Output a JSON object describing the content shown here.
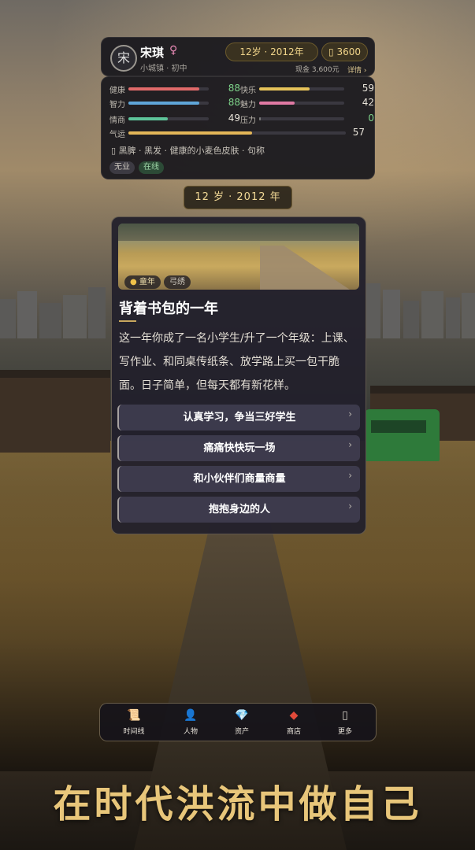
{
  "profile": {
    "avatar_char": "宋",
    "name": "宋琪",
    "gender_symbol": "♀",
    "location": "小城镇 · 初中",
    "age_label": "12岁 · 2012年",
    "coins": "3600",
    "cash": "现金 3,600元",
    "detail_label": "详情"
  },
  "stats": [
    {
      "label": "健康",
      "value": "88",
      "fraction": 0.88,
      "color": "#e06a6a",
      "value_color": "#7ed38a"
    },
    {
      "label": "快乐",
      "value": "59",
      "fraction": 0.59,
      "color": "#e6c35a",
      "value_color": "#e9e4da"
    },
    {
      "label": "智力",
      "value": "88",
      "fraction": 0.88,
      "color": "#5fa6d9",
      "value_color": "#7ed38a"
    },
    {
      "label": "魅力",
      "value": "42",
      "fraction": 0.42,
      "color": "#e07aa4",
      "value_color": "#e9e4da"
    },
    {
      "label": "情商",
      "value": "49",
      "fraction": 0.49,
      "color": "#5ec49a",
      "value_color": "#e9e4da"
    },
    {
      "label": "压力",
      "value": "0",
      "fraction": 0.0,
      "color": "#7a7a7a",
      "value_color": "#7ed38a"
    },
    {
      "label": "气运",
      "value": "57",
      "fraction": 0.57,
      "color": "#e3b658",
      "value_color": "#e9e4da"
    }
  ],
  "appearance": "黑脾 · 黑发 · 健康的小麦色皮肤 · 句称",
  "tags": [
    "无业",
    "在线"
  ],
  "year_banner": "12 岁 · 2012 年",
  "event": {
    "chips": [
      "童年",
      "弓绣"
    ],
    "title": "背着书包的一年",
    "body": "这一年你成了一名小学生/升了一个年级：上课、写作业、和同桌传纸条、放学路上买一包干脆面。日子简单，但每天都有新花样。",
    "options": [
      "认真学习，争当三好学生",
      "痛痛快快玩一场",
      "和小伙伴们商量商量",
      "抱抱身边的人"
    ]
  },
  "nav": [
    {
      "label": "时间线",
      "icon": "scroll-icon",
      "glyph": "📜"
    },
    {
      "label": "人物",
      "icon": "person-icon",
      "glyph": "👤"
    },
    {
      "label": "资产",
      "icon": "diamond-icon",
      "glyph": "💎"
    },
    {
      "label": "商店",
      "icon": "shop-icon",
      "glyph": "◆"
    },
    {
      "label": "更多",
      "icon": "more-icon",
      "glyph": "▯"
    }
  ],
  "slogan": "在时代洪流中做自己",
  "colors": {
    "accent": "#e8c67a",
    "gold_text": "#f0d48a"
  }
}
